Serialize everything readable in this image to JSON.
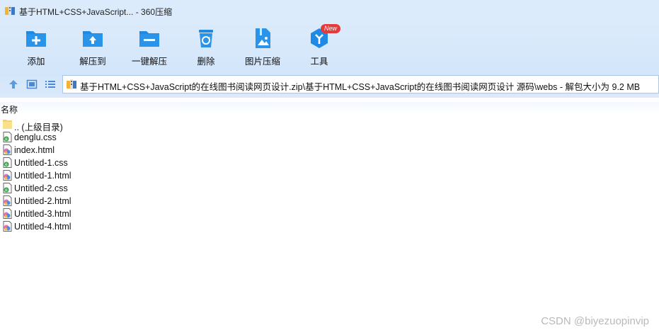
{
  "window": {
    "title": "基于HTML+CSS+JavaScript... - 360压缩"
  },
  "toolbar": {
    "items": [
      {
        "label": "添加",
        "icon": "add-icon"
      },
      {
        "label": "解压到",
        "icon": "extract-to-icon"
      },
      {
        "label": "一键解压",
        "icon": "one-click-extract-icon"
      },
      {
        "label": "删除",
        "icon": "recycle-icon"
      },
      {
        "label": "图片压缩",
        "icon": "image-compress-icon"
      },
      {
        "label": "工具",
        "icon": "tools-icon",
        "badge": "New"
      }
    ]
  },
  "address": {
    "path": "基于HTML+CSS+JavaScript的在线图书阅读网页设计.zip\\基于HTML+CSS+JavaScript的在线图书阅读网页设计 源码\\webs - 解包大小为 9.2 MB"
  },
  "file_list": {
    "column_header": "名称",
    "files": [
      {
        "name": ".. (上级目录)",
        "type": "folder"
      },
      {
        "name": "denglu.css",
        "type": "css"
      },
      {
        "name": "index.html",
        "type": "html"
      },
      {
        "name": "Untitled-1.css",
        "type": "css"
      },
      {
        "name": "Untitled-1.html",
        "type": "html"
      },
      {
        "name": "Untitled-2.css",
        "type": "css"
      },
      {
        "name": "Untitled-2.html",
        "type": "html"
      },
      {
        "name": "Untitled-3.html",
        "type": "html"
      },
      {
        "name": "Untitled-4.html",
        "type": "html"
      }
    ]
  },
  "watermark": "CSDN @biyezuopinvip",
  "colors": {
    "titlebar_bg": "#dcebfb",
    "icon_blue": "#1f8ae6",
    "badge_red": "#e23b3b"
  }
}
